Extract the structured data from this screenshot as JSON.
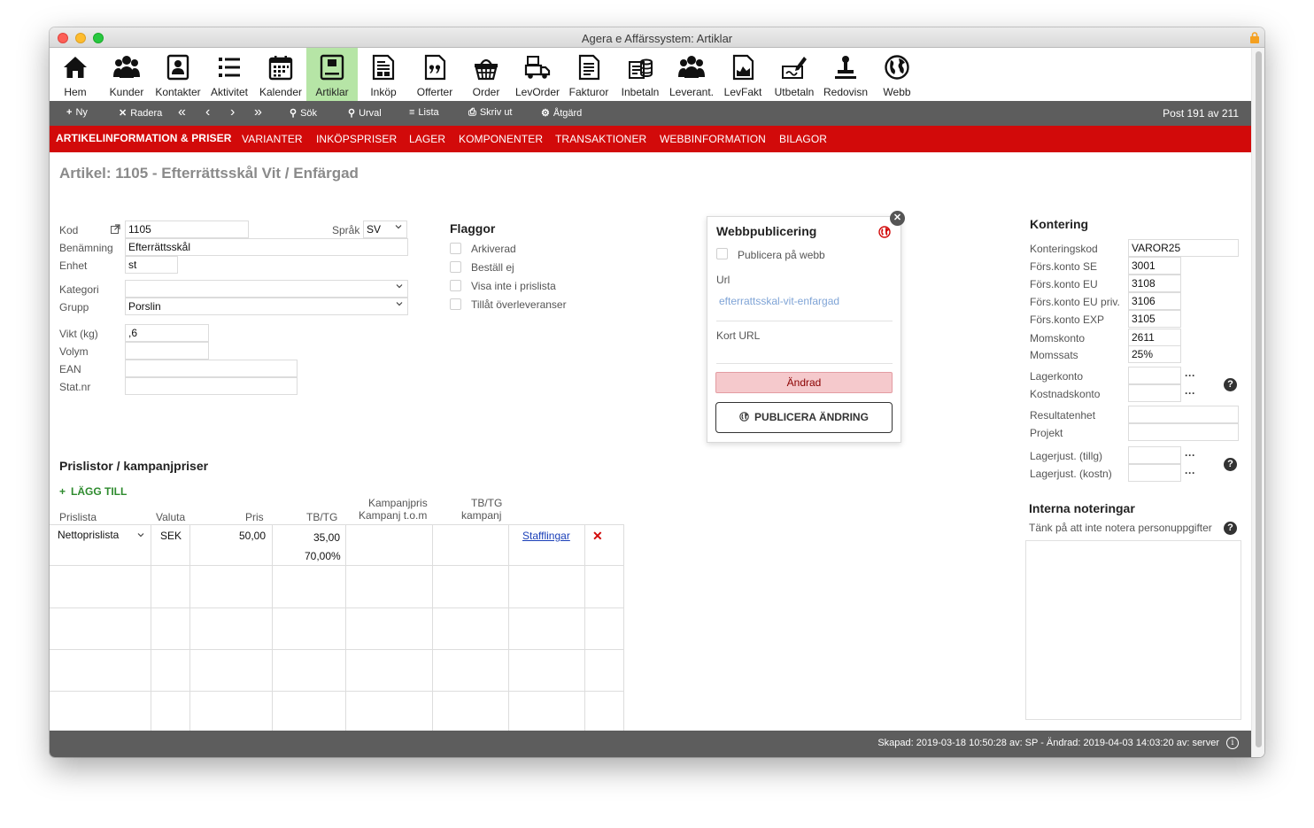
{
  "window": {
    "title": "Agera e Affärssystem: Artiklar"
  },
  "toolbar": [
    {
      "label": "Hem",
      "icon": "home-icon"
    },
    {
      "label": "Kunder",
      "icon": "customers-icon"
    },
    {
      "label": "Kontakter",
      "icon": "contacts-icon"
    },
    {
      "label": "Aktivitet",
      "icon": "activity-list-icon"
    },
    {
      "label": "Kalender",
      "icon": "calendar-icon"
    },
    {
      "label": "Artiklar",
      "icon": "articles-icon",
      "active": true
    },
    {
      "label": "Inköp",
      "icon": "purchase-icon"
    },
    {
      "label": "Offerter",
      "icon": "quote-icon"
    },
    {
      "label": "Order",
      "icon": "basket-icon"
    },
    {
      "label": "LevOrder",
      "icon": "truck-icon"
    },
    {
      "label": "Fakturor",
      "icon": "invoice-icon"
    },
    {
      "label": "Inbetaln",
      "icon": "payment-in-icon"
    },
    {
      "label": "Leverant.",
      "icon": "suppliers-icon"
    },
    {
      "label": "LevFakt",
      "icon": "supplier-invoice-icon"
    },
    {
      "label": "Utbetaln",
      "icon": "payment-out-icon"
    },
    {
      "label": "Redovisn",
      "icon": "stamp-icon"
    },
    {
      "label": "Webb",
      "icon": "globe-icon"
    }
  ],
  "actions": {
    "new": "Ny",
    "delete": "Radera",
    "search": "Sök",
    "filter": "Urval",
    "list": "Lista",
    "print": "Skriv ut",
    "action": "Åtgärd",
    "post": "Post 191 av 211"
  },
  "tabs": [
    "ARTIKELINFORMATION & PRISER",
    "VARIANTER",
    "INKÖPSPRISER",
    "LAGER",
    "KOMPONENTER",
    "TRANSAKTIONER",
    "WEBBINFORMATION",
    "BILAGOR"
  ],
  "header": {
    "title": "Artikel:  1105 - Efterrättsskål Vit / Enfärgad"
  },
  "form": {
    "kod_label": "Kod",
    "kod": "1105",
    "sprak_label": "Språk",
    "sprak": "SV",
    "benamning_label": "Benämning",
    "benamning": "Efterrättsskål",
    "enhet_label": "Enhet",
    "enhet": "st",
    "kategori_label": "Kategori",
    "kategori": "",
    "grupp_label": "Grupp",
    "grupp": "Porslin",
    "vikt_label": "Vikt (kg)",
    "vikt": ",6",
    "volym_label": "Volym",
    "volym": "",
    "ean_label": "EAN",
    "ean": "",
    "statnr_label": "Stat.nr",
    "statnr": ""
  },
  "flags": {
    "title": "Flaggor",
    "items": [
      "Arkiverad",
      "Beställ ej",
      "Visa inte i prislista",
      "Tillåt överleveranser"
    ]
  },
  "web": {
    "title": "Webbpublicering",
    "publish_label": "Publicera på webb",
    "url_label": "Url",
    "url": "efterrattsskal-vit-enfargad",
    "short_url_label": "Kort URL",
    "changed": "Ändrad",
    "publish_button": "PUBLICERA ÄNDRING"
  },
  "kontering": {
    "title": "Kontering",
    "rows": [
      {
        "label": "Konteringskod",
        "value": "VAROR25"
      },
      {
        "label": "Förs.konto SE",
        "value": "3001"
      },
      {
        "label": "Förs.konto EU",
        "value": "3108"
      },
      {
        "label": "Förs.konto EU priv.",
        "value": "3106"
      },
      {
        "label": "Förs.konto EXP",
        "value": "3105"
      },
      {
        "label": "Momskonto",
        "value": "2611"
      },
      {
        "label": "Momssats",
        "value": "25%"
      }
    ],
    "lagerkonto": "Lagerkonto",
    "kostnadskonto": "Kostnadskonto",
    "resultatenhet": "Resultatenhet",
    "projekt": "Projekt",
    "lagerjust_tillg": "Lagerjust. (tillg)",
    "lagerjust_kostn": "Lagerjust. (kostn)"
  },
  "notes": {
    "title": "Interna noteringar",
    "hint": "Tänk på att inte notera personuppgifter"
  },
  "pricelist": {
    "title": "Prislistor / kampanjpriser",
    "add": "LÄGG TILL",
    "columns": {
      "prislista": "Prislista",
      "valuta": "Valuta",
      "pris": "Pris",
      "tbtg": "TB/TG",
      "kampanjpris_1": "Kampanjpris",
      "kampanjpris_2": "Kampanj t.o.m",
      "tbtg_kampanj_1": "TB/TG",
      "tbtg_kampanj_2": "kampanj"
    },
    "row": {
      "prislista": "Nettoprislista",
      "valuta": "SEK",
      "pris": "50,00",
      "tb": "35,00",
      "tg": "70,00%",
      "link": "Stafflingar"
    }
  },
  "footer": {
    "text": "Skapad: 2019-03-18 10:50:28 av: SP - Ändrad: 2019-04-03 14:03:20 av: server"
  }
}
